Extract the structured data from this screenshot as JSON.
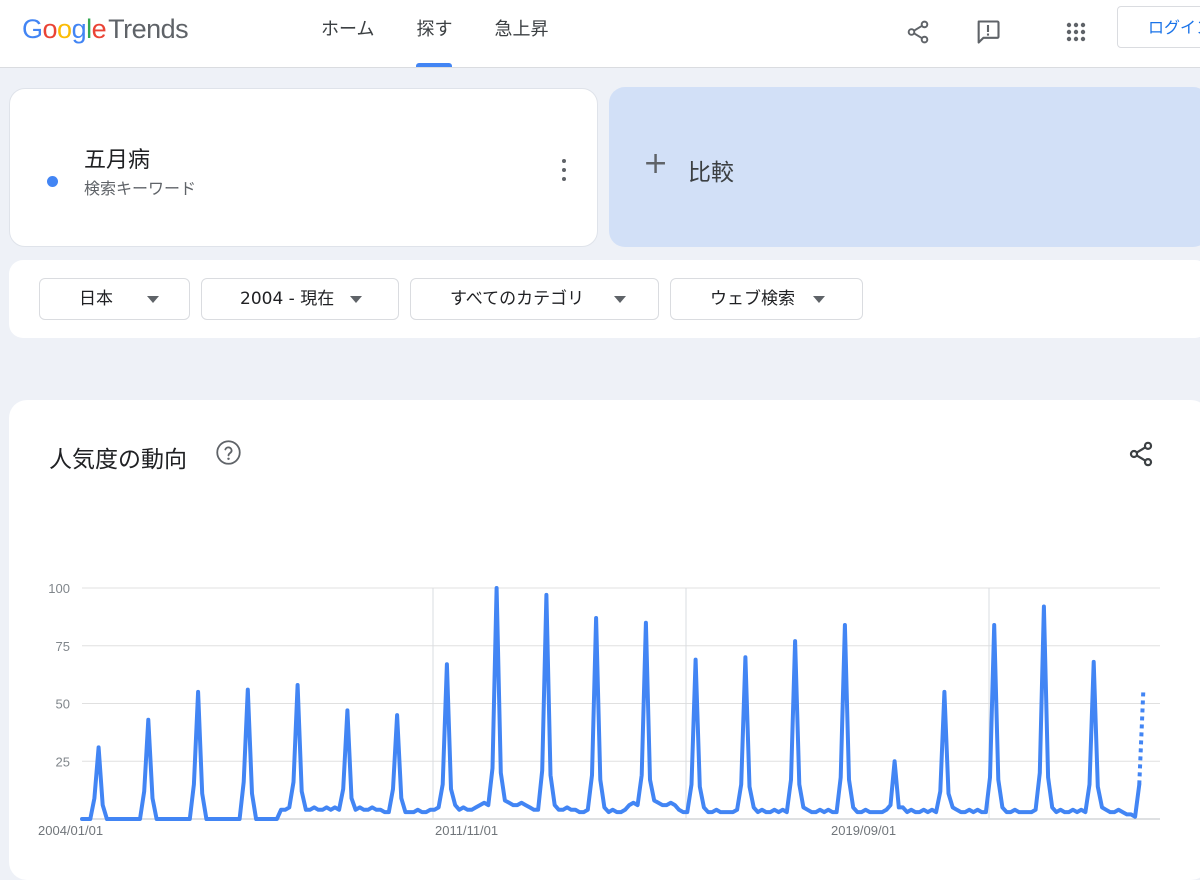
{
  "header": {
    "logo": {
      "google": [
        "G",
        "o",
        "o",
        "g",
        "l",
        "e"
      ],
      "trends": "Trends"
    },
    "nav": [
      "ホーム",
      "探す",
      "急上昇"
    ],
    "active_nav": 1,
    "login": "ログイン",
    "icons": [
      "share-icon",
      "feedback-icon",
      "apps-grid-icon"
    ]
  },
  "term": {
    "title": "五月病",
    "subtitle": "検索キーワード",
    "dot_color": "#4285f4"
  },
  "compare": {
    "label": "比較"
  },
  "filters": [
    "日本",
    "2004 - 現在",
    "すべてのカテゴリ",
    "ウェブ検索"
  ],
  "chart_card": {
    "title": "人気度の動向"
  },
  "chart_data": {
    "type": "line",
    "series_color": "#4285f4",
    "x_tick_labels": [
      "2004/01/01",
      "2011/11/01",
      "2019/09/01"
    ],
    "y_ticks": [
      25,
      50,
      75,
      100
    ],
    "ylim": [
      0,
      100
    ],
    "grid": true,
    "start_year": 2004,
    "dotted_tail": true,
    "yearly_may_peaks": [
      31,
      43,
      55,
      56,
      58,
      47,
      45,
      67,
      100,
      97,
      87,
      85,
      69,
      70,
      77,
      84,
      25,
      55,
      84,
      92,
      68
    ],
    "current_partial_peak": 55
  }
}
